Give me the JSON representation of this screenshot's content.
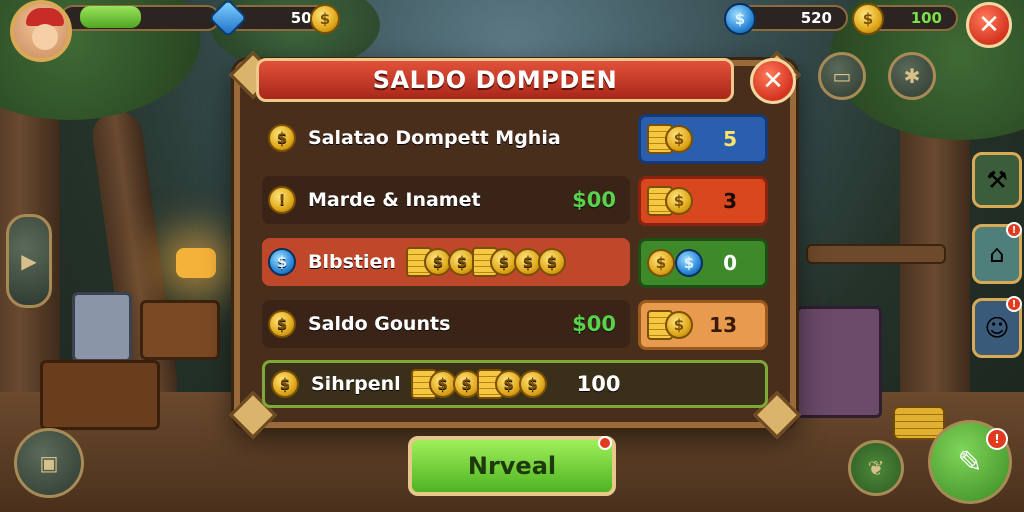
{
  "hud": {
    "xp_fill_fraction": 0.45,
    "gems": "500",
    "coins": "520",
    "cash": "100"
  },
  "panel": {
    "title": "SALDO DOMPDEN",
    "rows": [
      {
        "label": "Salatao Dompett Mghia",
        "amount": "",
        "icon": "coin-icon",
        "badge_value": "5",
        "badge_color": "#2a5fb0"
      },
      {
        "label": "Marde & Inamet",
        "amount": "$00",
        "icon": "coin-icon",
        "badge_value": "3",
        "badge_color": "#d9471f"
      },
      {
        "label": "Blbstien",
        "amount": "",
        "icon": "blue-coin-icon",
        "badge_value": "0",
        "badge_color": "#3e8a2a"
      },
      {
        "label": "Saldo Gounts",
        "amount": "$00",
        "icon": "coin-icon",
        "badge_value": "13",
        "badge_color": "#e89a4e"
      },
      {
        "label": "Sihrpenl",
        "amount": "100",
        "icon": "coin-icon",
        "badge_value": "",
        "badge_color": ""
      }
    ]
  },
  "action_button": {
    "label": "Nrveal"
  },
  "colors": {
    "accent_green": "#57d24a",
    "title_red": "#c33a26"
  }
}
